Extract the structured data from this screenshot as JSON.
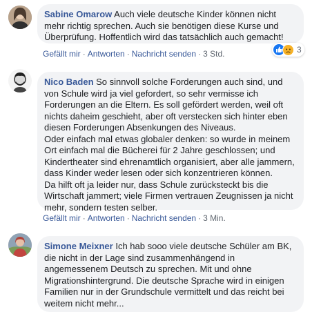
{
  "actions": {
    "like": "Gefällt mir",
    "reply": "Antworten",
    "send_message": "Nachricht senden",
    "separator": "·"
  },
  "comments": [
    {
      "author": "Sabine Omarow",
      "lines": [
        "Auch viele deutsche Kinder können nicht",
        "mehr richtig sprechen. Auch sie benötigen diese Kurse und",
        "Überprüfung. Hoffentlich wird das tatsächlich auch gemacht!"
      ],
      "timestamp": "3 Std.",
      "reaction_count": "3",
      "reaction_icons": [
        "like-icon",
        "sad-icon"
      ]
    },
    {
      "author": "Nico Baden",
      "lines": [
        "So sinnvoll solche Forderungen auch sind, und",
        "von Schule wird ja viel gefordert, so sehr vermisse ich",
        "Forderungen an die Eltern. Es soll gefördert werden, weil oft",
        "nichts daheim geschieht, aber oft verstecken sich hinter eben",
        "diesen Forderungen Absenkungen des Niveaus.",
        "Oder einfach mal etwas globaler denken: so wurde in meinem",
        "Ort einfach mal die Bücherei für 2 Jahre geschlossen; und",
        "Kindertheater sind ehrenamtlich organisiert, aber alle jammern,",
        "dass Kinder weder lesen oder sich konzentrieren können.",
        "Da hilft oft ja leider nur, dass Schule zurücksteckt bis die",
        "Wirtschaft jammert; viele Firmen vertrauen Zeugnissen ja nicht",
        "mehr, sondern testen selber."
      ],
      "timestamp": "3 Min."
    },
    {
      "author": "Simone Meixner",
      "lines": [
        "Ich hab sooo viele deutsche Schüler am BK,",
        "die nicht in der Lage sind zusammenhängend in",
        "angemessenem Deutsch zu sprechen. Mit und ohne",
        "Migrationshintergrund. Die deutsche Sprache wird in einigen",
        "Familien nur in der Grundschule vermittelt und das reicht bei",
        "weitem nicht mehr..."
      ]
    }
  ],
  "colors": {
    "name": "#385898",
    "bubble": "#f2f3f5",
    "meta": "#606770",
    "like": "#1877f2",
    "sad": "#f7b125"
  }
}
